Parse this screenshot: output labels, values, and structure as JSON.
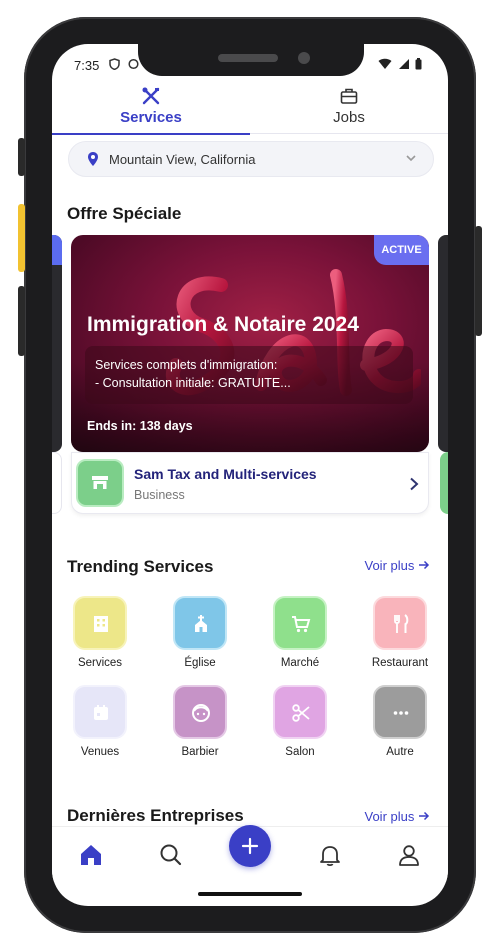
{
  "status": {
    "time": "7:35"
  },
  "tabs": [
    {
      "label": "Services",
      "icon": "tools-icon",
      "active": true
    },
    {
      "label": "Jobs",
      "icon": "briefcase-icon",
      "active": false
    }
  ],
  "location": {
    "text": "Mountain View, California",
    "icon": "location-pin-icon"
  },
  "offers": {
    "title": "Offre Spéciale",
    "card": {
      "badge": "ACTIVE",
      "title": "Immigration & Notaire 2024",
      "desc_line1": "Services complets d'immigration:",
      "desc_line2": "- Consultation initiale: GRATUITE...",
      "ends": "Ends in: 138 days",
      "business_name": "Sam Tax and Multi-services",
      "business_type": "Business"
    }
  },
  "trending": {
    "title": "Trending Services",
    "more": "Voir plus",
    "items": [
      {
        "label": "Services",
        "icon": "building-icon",
        "color": "#ede789"
      },
      {
        "label": "Église",
        "icon": "church-icon",
        "color": "#7fc6e8"
      },
      {
        "label": "Marché",
        "icon": "cart-icon",
        "color": "#8fe08c"
      },
      {
        "label": "Restaurant",
        "icon": "fork-knife-icon",
        "color": "#f9b4bb"
      },
      {
        "label": "Venues",
        "icon": "calendar-icon",
        "color": "#e6e6f8"
      },
      {
        "label": "Barbier",
        "icon": "face-icon",
        "color": "#c693c7"
      },
      {
        "label": "Salon",
        "icon": "scissors-icon",
        "color": "#e0a5e3"
      },
      {
        "label": "Autre",
        "icon": "more-dots-icon",
        "color": "#9c9c9c"
      }
    ]
  },
  "latest": {
    "title": "Dernières Entreprises",
    "more": "Voir plus"
  },
  "accent_color": "#3a3fc6"
}
